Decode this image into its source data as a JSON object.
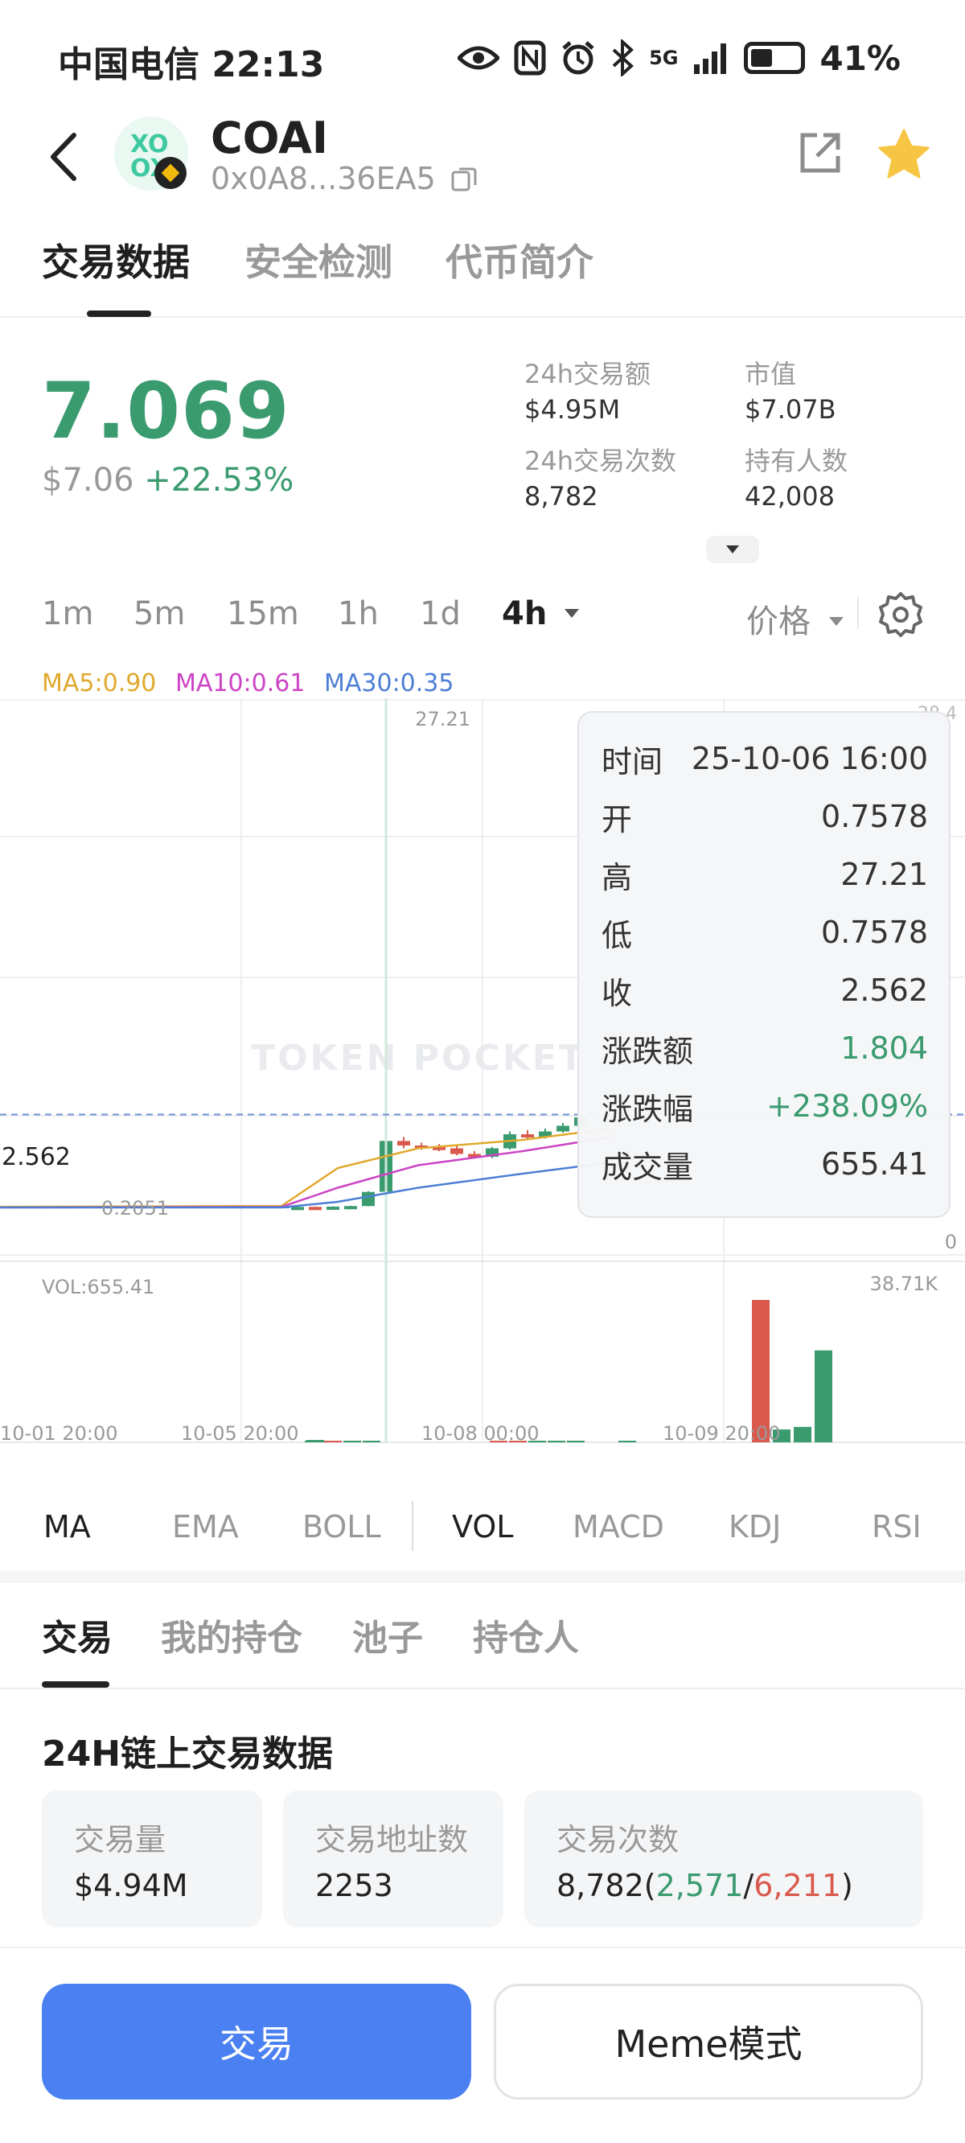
{
  "status_bar": {
    "carrier_time": "中国电信 22:13",
    "network": "5G",
    "battery": "41%"
  },
  "header": {
    "token_name": "COAI",
    "address": "0x0A8...36EA5"
  },
  "main_tabs": [
    {
      "label": "交易数据",
      "active": true
    },
    {
      "label": "安全检测",
      "active": false
    },
    {
      "label": "代币简介",
      "active": false
    }
  ],
  "price": {
    "current": "7.069",
    "usd": "$7.06",
    "change": "+22.53%"
  },
  "stats": [
    {
      "label": "24h交易额",
      "value": "$4.95M"
    },
    {
      "label": "市值",
      "value": "$7.07B"
    },
    {
      "label": "24h交易次数",
      "value": "8,782"
    },
    {
      "label": "持有人数",
      "value": "42,008"
    }
  ],
  "intervals": [
    {
      "label": "1m",
      "active": false
    },
    {
      "label": "5m",
      "active": false
    },
    {
      "label": "15m",
      "active": false
    },
    {
      "label": "1h",
      "active": false
    },
    {
      "label": "1d",
      "active": false
    },
    {
      "label": "4h",
      "active": true
    }
  ],
  "price_mode": "价格",
  "ma_legend": [
    {
      "label": "MA5:0.90",
      "color": "#e0a92e"
    },
    {
      "label": "MA10:0.61",
      "color": "#cc44c4"
    },
    {
      "label": "MA30:0.35",
      "color": "#4d7fd6"
    }
  ],
  "chart_data": {
    "type": "candlestick",
    "top_label": "27.21",
    "right_top_label": "28.4",
    "right_bottom_label": "0",
    "current_price_label": "2.562",
    "low_label": "0.2051",
    "vol_label": "VOL:655.41",
    "vol_max_label": "38.71K",
    "x_tick_labels": [
      "10-01 20:00",
      "10-05 20:00",
      "10-08 00:00",
      "10-09 20:00"
    ],
    "candles": [
      {
        "o": 0.2,
        "c": 0.22,
        "h": 0.23,
        "l": 0.19,
        "up": true
      },
      {
        "o": 0.22,
        "c": 0.21,
        "h": 0.23,
        "l": 0.2,
        "up": false
      },
      {
        "o": 0.21,
        "c": 0.23,
        "h": 0.24,
        "l": 0.2,
        "up": true
      },
      {
        "o": 0.23,
        "c": 0.25,
        "h": 0.26,
        "l": 0.22,
        "up": true
      },
      {
        "o": 0.25,
        "c": 0.75,
        "h": 0.78,
        "l": 0.24,
        "up": true
      },
      {
        "o": 0.7578,
        "c": 2.562,
        "h": 27.21,
        "l": 0.7578,
        "up": true
      },
      {
        "o": 2.56,
        "c": 2.4,
        "h": 2.7,
        "l": 2.3,
        "up": false
      },
      {
        "o": 2.4,
        "c": 2.35,
        "h": 2.5,
        "l": 2.25,
        "up": false
      },
      {
        "o": 2.35,
        "c": 2.3,
        "h": 2.45,
        "l": 2.2,
        "up": false
      },
      {
        "o": 2.3,
        "c": 2.1,
        "h": 2.4,
        "l": 2.05,
        "up": false
      },
      {
        "o": 2.1,
        "c": 2.0,
        "h": 2.2,
        "l": 1.95,
        "up": false
      },
      {
        "o": 2.0,
        "c": 2.3,
        "h": 2.35,
        "l": 1.95,
        "up": true
      },
      {
        "o": 2.3,
        "c": 2.8,
        "h": 2.9,
        "l": 2.25,
        "up": true
      },
      {
        "o": 2.8,
        "c": 2.7,
        "h": 2.95,
        "l": 2.65,
        "up": false
      },
      {
        "o": 2.7,
        "c": 2.9,
        "h": 3.0,
        "l": 2.65,
        "up": true
      },
      {
        "o": 2.9,
        "c": 3.1,
        "h": 3.2,
        "l": 2.85,
        "up": true
      },
      {
        "o": 3.1,
        "c": 3.4,
        "h": 3.5,
        "l": 3.0,
        "up": true
      }
    ],
    "volume": [
      {
        "v": 120,
        "up": true
      },
      {
        "v": 80,
        "up": false
      },
      {
        "v": 90,
        "up": true
      },
      {
        "v": 100,
        "up": true
      },
      {
        "v": 655.41,
        "up": true
      },
      {
        "v": 200,
        "up": false
      },
      {
        "v": 180,
        "up": false
      },
      {
        "v": 260,
        "up": true
      },
      {
        "v": 300,
        "up": true
      },
      {
        "v": 250,
        "up": true
      },
      {
        "v": 160,
        "up": true
      },
      {
        "v": 38710,
        "up": false
      },
      {
        "v": 3500,
        "up": true
      },
      {
        "v": 4200,
        "up": true
      },
      {
        "v": 25000,
        "up": true
      }
    ]
  },
  "tooltip": [
    {
      "label": "时间",
      "value": "25-10-06 16:00",
      "color": "#333333"
    },
    {
      "label": "开",
      "value": "0.7578",
      "color": "#333333"
    },
    {
      "label": "高",
      "value": "27.21",
      "color": "#333333"
    },
    {
      "label": "低",
      "value": "0.7578",
      "color": "#333333"
    },
    {
      "label": "收",
      "value": "2.562",
      "color": "#333333"
    },
    {
      "label": "涨跌额",
      "value": "1.804",
      "color": "#3a9b6f"
    },
    {
      "label": "涨跌幅",
      "value": "+238.09%",
      "color": "#3a9b6f"
    },
    {
      "label": "成交量",
      "value": "655.41",
      "color": "#333333"
    }
  ],
  "indicators": [
    {
      "label": "MA",
      "active": true
    },
    {
      "label": "EMA",
      "active": false
    },
    {
      "label": "BOLL",
      "active": false
    },
    {
      "label": "VOL",
      "active": true
    },
    {
      "label": "MACD",
      "active": false
    },
    {
      "label": "KDJ",
      "active": false
    },
    {
      "label": "RSI",
      "active": false
    }
  ],
  "bottom_tabs": [
    {
      "label": "交易",
      "active": true
    },
    {
      "label": "我的持仓",
      "active": false
    },
    {
      "label": "池子",
      "active": false
    },
    {
      "label": "持仓人",
      "active": false
    }
  ],
  "onchain": {
    "title": "24H链上交易数据",
    "volume_label": "交易量",
    "volume_value": "$4.94M",
    "addresses_label": "交易地址数",
    "addresses_value": "2253",
    "txcount_label": "交易次数",
    "txcount_total": "8,782",
    "txcount_buy": "2,571",
    "txcount_sell": "6,211"
  },
  "actions": {
    "trade": "交易",
    "meme": "Meme模式"
  },
  "colors": {
    "up": "#3a9b6f",
    "down": "#d9594c",
    "primary": "#4a80f2"
  }
}
